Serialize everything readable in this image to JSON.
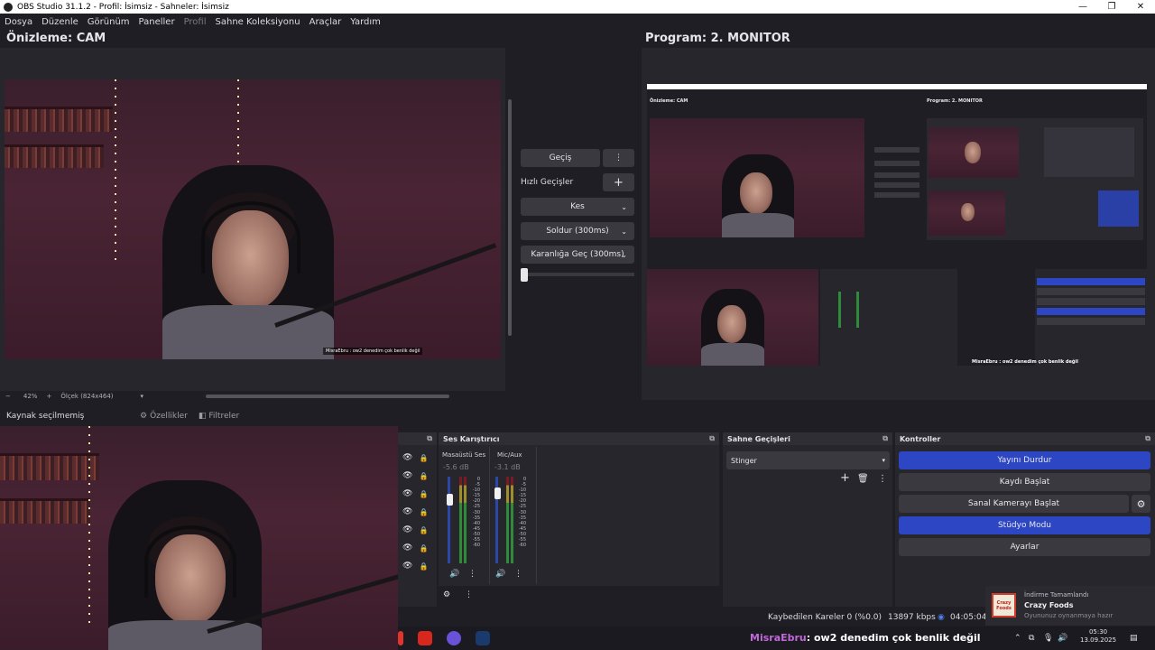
{
  "window": {
    "title": "OBS Studio 31.1.2 - Profil: İsimsiz - Sahneler: İsimsiz",
    "minimize": "—",
    "restore": "❐",
    "close": "✕"
  },
  "menu": [
    "Dosya",
    "Düzenle",
    "Görünüm",
    "Paneller",
    "Profil",
    "Sahne Koleksiyonu",
    "Araçlar",
    "Yardım"
  ],
  "preview": {
    "title": "Önizleme: CAM",
    "zoom_out": "−",
    "zoom_value": "42%",
    "zoom_in": "+",
    "scale_label": "Ölçek (824x464)",
    "scale_chevron": "▾"
  },
  "program": {
    "title": "Program: 2. MONITOR",
    "mini_title": "Program: 2. MONITOR",
    "mini_preview_title": "Önizleme: CAM"
  },
  "transition_panel": {
    "transition_button": "Geçiş",
    "more": "⋮",
    "quick_label": "Hızlı Geçişler",
    "add": "+",
    "items": [
      "Kes",
      "Soldur (300ms)",
      "Karanlığa Geç (300ms)"
    ],
    "chevron": "⌄"
  },
  "source_bar": {
    "no_source": "Kaynak seçilmemiş",
    "properties": "Özellikler",
    "filters": "Filtreler",
    "gear": "⚙",
    "filter_icon": "◧"
  },
  "mixer": {
    "title": "Ses Karıştırıcı",
    "channels": [
      {
        "name": "Masaüstü Ses",
        "db": "-5.6 dB"
      },
      {
        "name": "Mic/Aux",
        "db": "-3.1 dB"
      }
    ],
    "scale": [
      "0",
      "-5",
      "-10",
      "-15",
      "-20",
      "-25",
      "-30",
      "-35",
      "-40",
      "-45",
      "-50",
      "-55",
      "-60"
    ],
    "speaker": "🔊",
    "more": "⋮",
    "settings": "⚙"
  },
  "scene_transitions": {
    "title": "Sahne Geçişleri",
    "selected": "Stinger",
    "chevron": "▾",
    "add": "+",
    "delete": "🗑",
    "more": "⋮"
  },
  "controls": {
    "title": "Kontroller",
    "buttons": [
      "Yayını Durdur",
      "Kaydı Başlat",
      "Sanal Kamerayı Başlat",
      "Stüdyo Modu",
      "Ayarlar"
    ],
    "active": [
      true,
      false,
      false,
      true,
      false
    ],
    "gear": "⚙"
  },
  "pop_icon": "⧉",
  "status": {
    "dropped": "Kaybedilen Kareler 0 (%0.0)",
    "bitrate": "13897 kbps",
    "time": "04:05:04",
    "live_icon": "◉"
  },
  "chat": {
    "user": "MisraEbru",
    "message": ": ow2 denedim çok benlik değil",
    "small_line": "MisraEbru : ow2 denedim çok benlik değil"
  },
  "toast": {
    "header": "İndirme Tamamlandı",
    "title": "Crazy Foods",
    "subtitle": "Oyununuz oynanmaya hazır",
    "logo_text": "Crazy Foods"
  },
  "clock": {
    "time": "05:30",
    "date": "13.09.2025"
  },
  "tray_icons": [
    "⌃",
    "⧉",
    "🎙",
    "🔊",
    "☁"
  ],
  "notification_icon": "▤",
  "mini_controls": [
    "Yayını Durdur",
    "Kaydı Başlat",
    "Sanal Kamerayı Başlat",
    "Stüdyo Modu",
    "Ayarlar"
  ],
  "colors": {
    "active_button": "#2c46c4",
    "background": "#1f1e24",
    "panel": "#27262c"
  }
}
